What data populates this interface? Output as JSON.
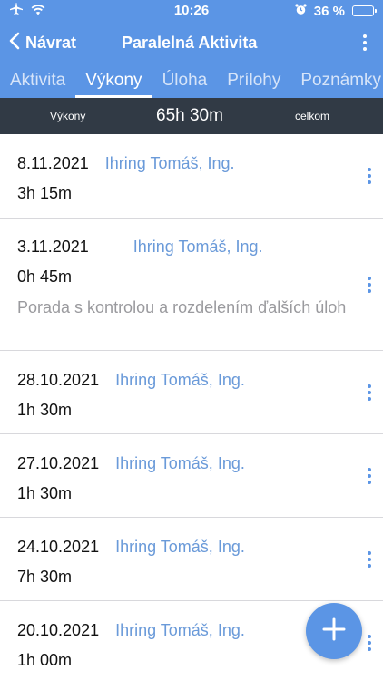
{
  "status": {
    "time": "10:26",
    "battery": "36 %"
  },
  "nav": {
    "back_label": "Návrat",
    "title": "Paralelná Aktivita"
  },
  "tabs": [
    {
      "label": "Aktivita",
      "active": false
    },
    {
      "label": "Výkony",
      "active": true
    },
    {
      "label": "Úloha",
      "active": false
    },
    {
      "label": "Prílohy",
      "active": false
    },
    {
      "label": "Poznámky",
      "active": false
    }
  ],
  "summary": {
    "label": "Výkony",
    "value": "65h 30m",
    "total_label": "celkom"
  },
  "entries": [
    {
      "date": "8.11.2021",
      "person": "Ihring Tomáš, Ing.",
      "duration": "3h 15m",
      "note": ""
    },
    {
      "date": "3.11.2021",
      "person": "Ihring Tomáš, Ing.",
      "duration": "0h 45m",
      "note": "Porada s kontrolou a rozdelením ďalších úloh"
    },
    {
      "date": "28.10.2021",
      "person": "Ihring Tomáš, Ing.",
      "duration": "1h 30m",
      "note": ""
    },
    {
      "date": "27.10.2021",
      "person": "Ihring Tomáš, Ing.",
      "duration": "1h 30m",
      "note": ""
    },
    {
      "date": "24.10.2021",
      "person": "Ihring Tomáš, Ing.",
      "duration": "7h 30m",
      "note": ""
    },
    {
      "date": "20.10.2021",
      "person": "Ihring Tomáš, Ing.",
      "duration": "1h 00m",
      "note": ""
    }
  ],
  "icons": {
    "airplane": "airplane-icon",
    "wifi": "wifi-icon",
    "alarm": "alarm-icon",
    "battery": "battery-icon",
    "back": "chevron-left-icon",
    "more": "more-vertical-icon",
    "add": "plus-icon"
  },
  "colors": {
    "accent": "#5b95e5",
    "summary_bg": "#313a45",
    "person_link": "#6a9ad9"
  }
}
